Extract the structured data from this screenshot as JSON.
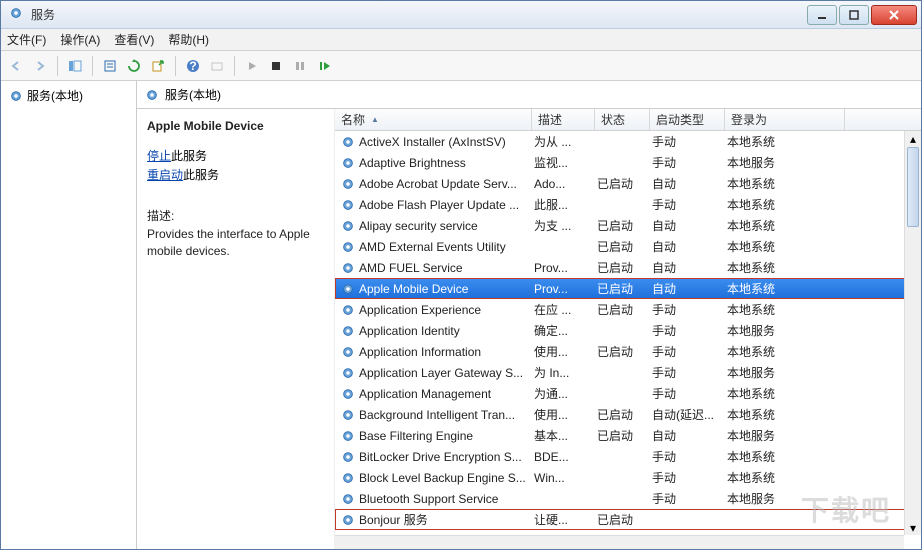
{
  "window": {
    "title": "服务"
  },
  "menu": {
    "file": "文件(F)",
    "action": "操作(A)",
    "view": "查看(V)",
    "help": "帮助(H)"
  },
  "nav": {
    "root": "服务(本地)"
  },
  "content_header": {
    "title": "服务(本地)"
  },
  "detail": {
    "title": "Apple Mobile Device",
    "stop_link": "停止",
    "stop_suffix": "此服务",
    "restart_link": "重启动",
    "restart_suffix": "此服务",
    "desc_label": "描述:",
    "desc": "Provides the interface to Apple mobile devices."
  },
  "columns": {
    "name": "名称",
    "desc": "描述",
    "status": "状态",
    "start": "启动类型",
    "logon": "登录为"
  },
  "rows": [
    {
      "name": "ActiveX Installer (AxInstSV)",
      "desc": "为从 ...",
      "status": "",
      "start": "手动",
      "logon": "本地系统"
    },
    {
      "name": "Adaptive Brightness",
      "desc": "监视...",
      "status": "",
      "start": "手动",
      "logon": "本地服务"
    },
    {
      "name": "Adobe Acrobat Update Serv...",
      "desc": "Ado...",
      "status": "已启动",
      "start": "自动",
      "logon": "本地系统"
    },
    {
      "name": "Adobe Flash Player Update ...",
      "desc": "此服...",
      "status": "",
      "start": "手动",
      "logon": "本地系统"
    },
    {
      "name": "Alipay security service",
      "desc": "为支 ...",
      "status": "已启动",
      "start": "自动",
      "logon": "本地系统"
    },
    {
      "name": "AMD External Events Utility",
      "desc": "",
      "status": "已启动",
      "start": "自动",
      "logon": "本地系统"
    },
    {
      "name": "AMD FUEL Service",
      "desc": "Prov...",
      "status": "已启动",
      "start": "自动",
      "logon": "本地系统"
    },
    {
      "name": "Apple Mobile Device",
      "desc": "Prov...",
      "status": "已启动",
      "start": "自动",
      "logon": "本地系统",
      "selected": true,
      "highlight": true
    },
    {
      "name": "Application Experience",
      "desc": "在应 ...",
      "status": "已启动",
      "start": "手动",
      "logon": "本地系统"
    },
    {
      "name": "Application Identity",
      "desc": "确定...",
      "status": "",
      "start": "手动",
      "logon": "本地服务"
    },
    {
      "name": "Application Information",
      "desc": "使用...",
      "status": "已启动",
      "start": "手动",
      "logon": "本地系统"
    },
    {
      "name": "Application Layer Gateway S...",
      "desc": "为 In...",
      "status": "",
      "start": "手动",
      "logon": "本地服务"
    },
    {
      "name": "Application Management",
      "desc": "为通...",
      "status": "",
      "start": "手动",
      "logon": "本地系统"
    },
    {
      "name": "Background Intelligent Tran...",
      "desc": "使用...",
      "status": "已启动",
      "start": "自动(延迟...",
      "logon": "本地系统"
    },
    {
      "name": "Base Filtering Engine",
      "desc": "基本...",
      "status": "已启动",
      "start": "自动",
      "logon": "本地服务"
    },
    {
      "name": "BitLocker Drive Encryption S...",
      "desc": "BDE...",
      "status": "",
      "start": "手动",
      "logon": "本地系统"
    },
    {
      "name": "Block Level Backup Engine S...",
      "desc": "Win...",
      "status": "",
      "start": "手动",
      "logon": "本地系统"
    },
    {
      "name": "Bluetooth Support Service",
      "desc": "",
      "status": "",
      "start": "手动",
      "logon": "本地服务"
    },
    {
      "name": "Bonjour 服务",
      "desc": "让硬...",
      "status": "已启动",
      "start": "",
      "logon": "",
      "highlight": true
    }
  ],
  "watermark": "下载吧"
}
